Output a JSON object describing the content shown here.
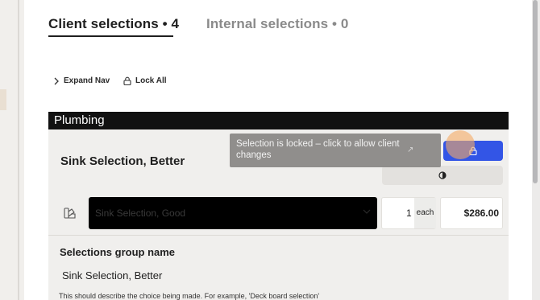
{
  "tabs": [
    {
      "label": "Client selections • 4",
      "active": true
    },
    {
      "label": "Internal selections • 0",
      "active": false
    }
  ],
  "toolbar": {
    "expand_nav_label": "Expand Nav",
    "lock_all_label": "Lock All"
  },
  "category": {
    "name": "Plumbing"
  },
  "selection": {
    "title": "Sink Selection, Better",
    "lock_tooltip": "Selection is locked – click to allow client changes",
    "option_select_value": "Sink Selection, Good",
    "quantity": "1",
    "unit": "each",
    "price": "$286.00"
  },
  "group_name_field": {
    "label": "Selections group name",
    "value": "Sink Selection, Better",
    "help_text": "This should describe the choice being made. For example, 'Deck board selection'"
  },
  "colors": {
    "accent": "#3355e6",
    "category_bar": "#111111",
    "tooltip_bg": "#8d8b89"
  }
}
